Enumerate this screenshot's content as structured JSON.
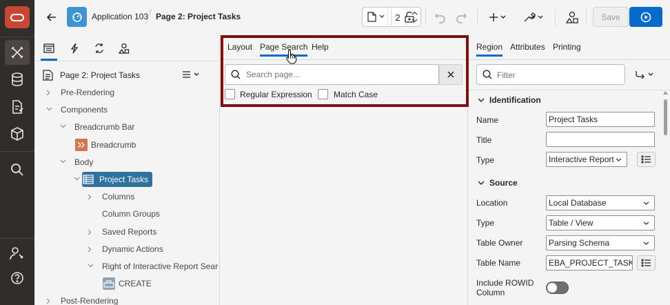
{
  "header": {
    "app_name": "Application 103",
    "page_name": "Page 2: Project Tasks",
    "page_number": "2",
    "save_label": "Save"
  },
  "left_pane": {
    "tabs": [
      "rendering-tab",
      "dynamic-actions-tab",
      "processing-tab",
      "shared-components-tab"
    ],
    "tree_root": "Page 2: Project Tasks",
    "tree": [
      {
        "label": "Pre-Rendering",
        "level": 0,
        "twisty": "collapsed"
      },
      {
        "label": "Components",
        "level": 0,
        "twisty": "expanded"
      },
      {
        "label": "Breadcrumb Bar",
        "level": 1,
        "twisty": "expanded"
      },
      {
        "label": "Breadcrumb",
        "level": 2,
        "icon": "breadcrumb"
      },
      {
        "label": "Body",
        "level": 1,
        "twisty": "expanded"
      },
      {
        "label": "Project Tasks",
        "level": 2,
        "icon": "report",
        "twisty": "expanded",
        "selected": true
      },
      {
        "label": "Columns",
        "level": 3,
        "twisty": "collapsed"
      },
      {
        "label": "Column Groups",
        "level": 3
      },
      {
        "label": "Saved Reports",
        "level": 3,
        "twisty": "collapsed"
      },
      {
        "label": "Dynamic Actions",
        "level": 3,
        "twisty": "collapsed"
      },
      {
        "label": "Right of Interactive Report Search B",
        "level": 3,
        "twisty": "expanded"
      },
      {
        "label": "CREATE",
        "level": 4,
        "icon": "button"
      },
      {
        "label": "Post-Rendering",
        "level": 0,
        "twisty": "collapsed"
      }
    ]
  },
  "center_pane": {
    "tabs": [
      "Layout",
      "Page Search",
      "Help"
    ],
    "active_tab": "Page Search",
    "search_placeholder": "Search page...",
    "search_value": "",
    "option_regex": "Regular Expression",
    "option_match_case": "Match Case"
  },
  "right_pane": {
    "tabs": [
      "Region",
      "Attributes",
      "Printing"
    ],
    "active_tab": "Region",
    "filter_placeholder": "Filter",
    "sections": {
      "identification": "Identification",
      "source": "Source"
    },
    "fields": {
      "name_label": "Name",
      "name_value": "Project Tasks",
      "title_label": "Title",
      "title_value": "",
      "type_label": "Type",
      "type_value": "Interactive Report",
      "location_label": "Location",
      "location_value": "Local Database",
      "source_type_label": "Type",
      "source_type_value": "Table / View",
      "table_owner_label": "Table Owner",
      "table_owner_value": "Parsing Schema",
      "table_name_label": "Table Name",
      "table_name_value": "EBA_PROJECT_TASKS",
      "rowid_label": "Include ROWID Column",
      "rowid_value": "off"
    }
  },
  "colors": {
    "accent": "#056ac8",
    "rail": "#312d2a",
    "oracle_red": "#c74634",
    "highlight_frame": "#7b1113",
    "tree_selected": "#30719e"
  }
}
